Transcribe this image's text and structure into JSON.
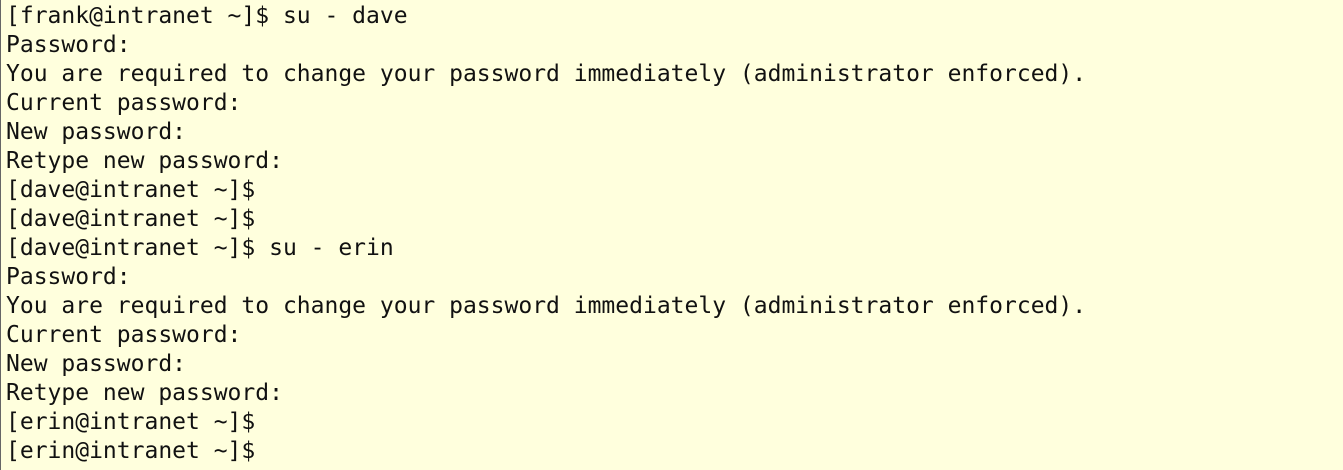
{
  "terminal": {
    "lines": [
      "[frank@intranet ~]$ su - dave",
      "Password:",
      "You are required to change your password immediately (administrator enforced).",
      "Current password:",
      "New password:",
      "Retype new password:",
      "[dave@intranet ~]$",
      "[dave@intranet ~]$",
      "[dave@intranet ~]$ su - erin",
      "Password:",
      "You are required to change your password immediately (administrator enforced).",
      "Current password:",
      "New password:",
      "Retype new password:",
      "[erin@intranet ~]$",
      "[erin@intranet ~]$"
    ]
  },
  "colors": {
    "background": "#ffffdd",
    "text": "#111111"
  }
}
